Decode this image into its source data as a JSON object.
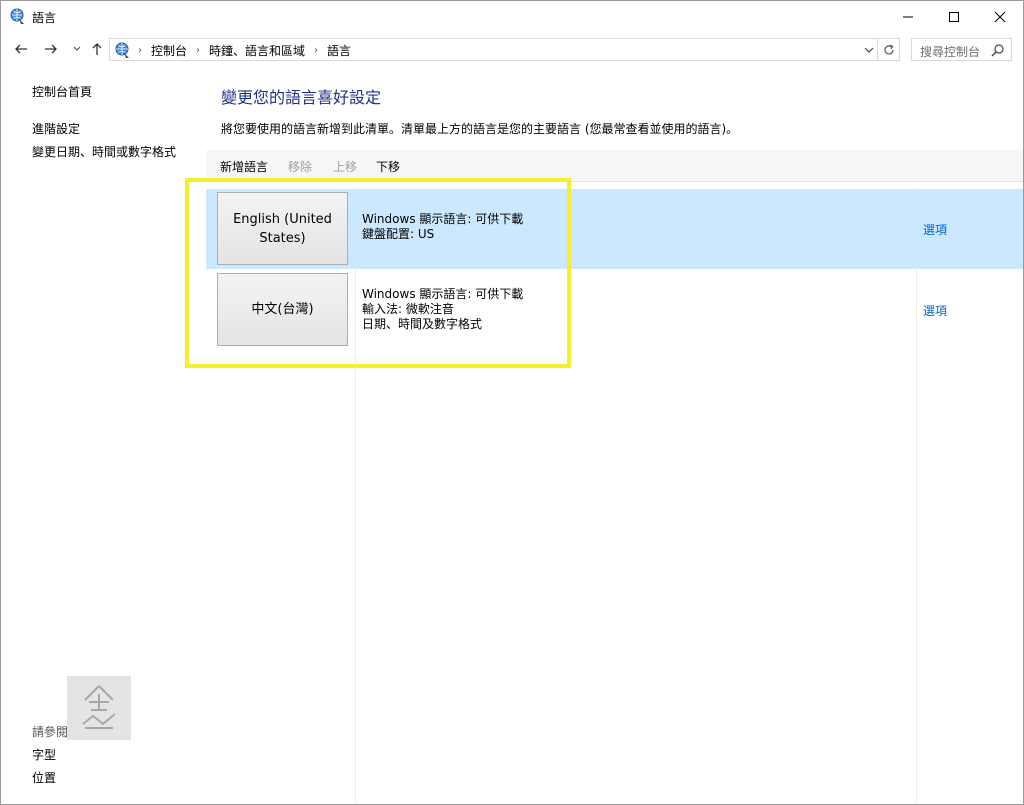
{
  "window": {
    "title": "語言",
    "controls": {
      "minimize": "minimize-icon",
      "maximize": "maximize-icon",
      "close": "close-icon"
    },
    "accent": "#1e3287"
  },
  "navigation": {
    "breadcrumbs": [
      "控制台",
      "時鐘、語言和區域",
      "語言"
    ],
    "search_placeholder": "搜尋控制台"
  },
  "sidebar": {
    "items": [
      "控制台首頁",
      "進階設定",
      "變更日期、時間或數字格式"
    ],
    "see_also_label": "請參閱",
    "see_also_items": [
      "字型",
      "位置"
    ]
  },
  "main": {
    "title": "變更您的語言喜好設定",
    "description": "將您要使用的語言新增到此清單。清單最上方的語言是您的主要語言 (您最常查看並使用的語言)。",
    "toolbar": [
      {
        "label": "新增語言",
        "enabled": true
      },
      {
        "label": "移除",
        "enabled": false
      },
      {
        "label": "上移",
        "enabled": false
      },
      {
        "label": "下移",
        "enabled": true
      }
    ],
    "languages": [
      {
        "name": "English (United States)",
        "details": [
          "Windows 顯示語言: 可供下載",
          "鍵盤配置: US"
        ],
        "options_label": "選項",
        "selected": true
      },
      {
        "name": "中文(台灣)",
        "details": [
          "Windows 顯示語言: 可供下載",
          "輸入法: 微軟注音",
          "日期、時間及數字格式"
        ],
        "options_label": "選項",
        "selected": false
      }
    ],
    "selected_row_color": "#cce8ff",
    "link_color": "#0066cc",
    "highlight_color": "#f7ef2e"
  }
}
